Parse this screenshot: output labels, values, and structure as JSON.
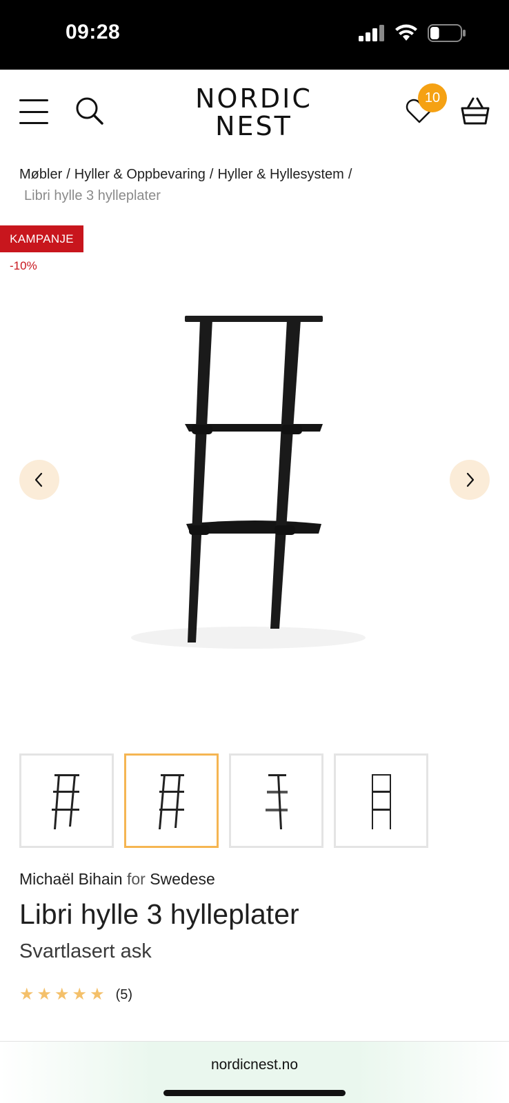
{
  "status_bar": {
    "time": "09:28",
    "battery_level": 0.3
  },
  "header": {
    "logo_line1": "NORDIC",
    "logo_line2": "NEST",
    "wishlist_count": "10"
  },
  "breadcrumb": {
    "items": [
      "Møbler",
      "Hyller & Oppbevaring",
      "Hyller & Hyllesystem"
    ],
    "separator": "/",
    "current": "Libri hylle 3 hylleplater"
  },
  "badges": {
    "campaign": "KAMPANJE",
    "discount": "-10%"
  },
  "gallery": {
    "thumbnail_count": 4,
    "active_thumbnail": 2
  },
  "product": {
    "designer": "Michaël Bihain",
    "for_text": "for",
    "brand": "Swedese",
    "title": "Libri hylle 3 hylleplater",
    "variant": "Svartlasert ask",
    "rating_value": 5,
    "rating_count": "(5)"
  },
  "browser": {
    "url": "nordicnest.no"
  },
  "colors": {
    "accent_orange": "#f5a113",
    "campaign_red": "#c8161d",
    "nav_button_bg": "#fbecd8",
    "star": "#f4c06a"
  },
  "icons": [
    "signal-icon",
    "wifi-icon",
    "battery-icon",
    "menu-icon",
    "search-icon",
    "heart-icon",
    "basket-icon",
    "chevron-left-icon",
    "chevron-right-icon",
    "star-icon"
  ]
}
